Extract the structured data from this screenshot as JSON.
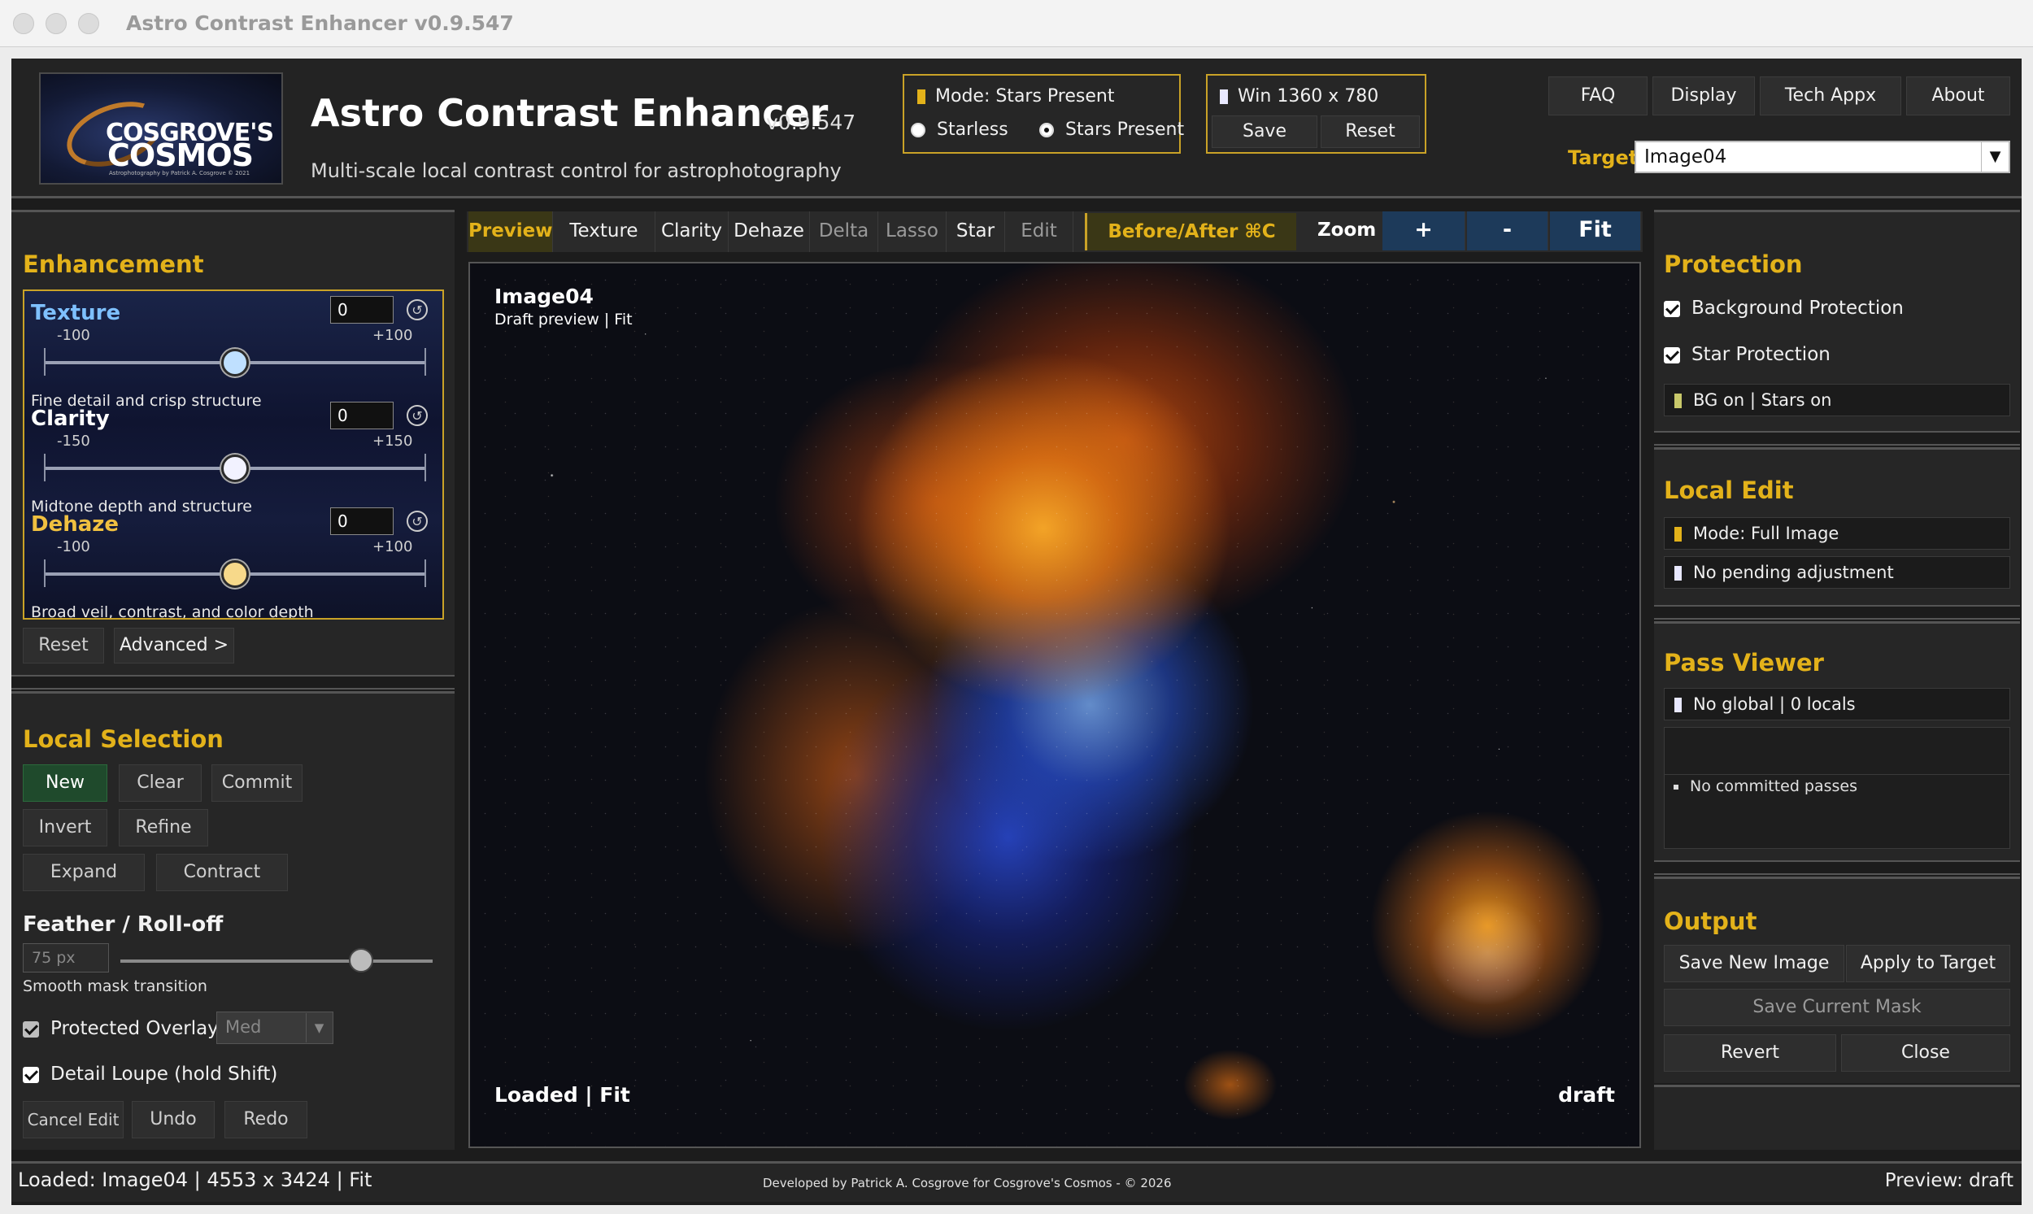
{
  "window": {
    "title": "Astro Contrast Enhancer v0.9.547"
  },
  "logo": {
    "line1": "COSGROVE'S",
    "line2": "COSMOS",
    "tagline": "Astrophotography by Patrick A. Cosgrove © 2021"
  },
  "header": {
    "title": "Astro Contrast Enhancer",
    "version": "v0.9.547",
    "subtitle": "Multi-scale local contrast control for astrophotography",
    "mode": {
      "label": "Mode: Stars Present",
      "options": [
        "Starless",
        "Stars Present"
      ],
      "selected": "Stars Present"
    },
    "window_size": {
      "label": "Win 1360 x 780",
      "save": "Save",
      "reset": "Reset"
    },
    "nav": [
      "FAQ",
      "Display",
      "Tech Appx",
      "About"
    ],
    "target_label": "Target",
    "target_value": "Image04"
  },
  "enhancement": {
    "heading": "Enhancement",
    "sliders": [
      {
        "name": "Texture",
        "value": "0",
        "min": "-100",
        "max": "+100",
        "desc": "Fine detail and crisp structure",
        "color": "#7ec0ff",
        "knob": "#bfe0ff"
      },
      {
        "name": "Clarity",
        "value": "0",
        "min": "-150",
        "max": "+150",
        "desc": "Midtone depth and structure",
        "color": "#ffffff",
        "knob": "#f2f2ff"
      },
      {
        "name": "Dehaze",
        "value": "0",
        "min": "-100",
        "max": "+100",
        "desc": "Broad veil, contrast, and color depth",
        "color": "#f0c040",
        "knob": "#f7d98a"
      }
    ],
    "reset": "Reset",
    "advanced": "Advanced >"
  },
  "local_selection": {
    "heading": "Local Selection",
    "buttons": {
      "new": "New",
      "clear": "Clear",
      "commit": "Commit",
      "invert": "Invert",
      "refine": "Refine",
      "expand": "Expand",
      "contract": "Contract"
    },
    "feather_heading": "Feather / Roll-off",
    "feather_value": "75 px",
    "feather_level": 0.77,
    "feather_desc": "Smooth mask transition",
    "protected_overlay": "Protected Overlay",
    "overlay_level": "Med",
    "detail_loupe": "Detail Loupe (hold Shift)",
    "cancel_edit": "Cancel Edit",
    "undo": "Undo",
    "redo": "Redo"
  },
  "tabs": [
    "Preview",
    "Texture",
    "Clarity",
    "Dehaze",
    "Delta",
    "Lasso",
    "Star",
    "Edit"
  ],
  "active_tab": "Preview",
  "before_after": "Before/After ⌘C",
  "zoom": {
    "label": "Zoom",
    "plus": "+",
    "minus": "-",
    "fit": "Fit"
  },
  "preview": {
    "image_name": "Image04",
    "info": "Draft preview | Fit",
    "status_left": "Loaded | Fit",
    "status_right": "draft"
  },
  "protection": {
    "heading": "Protection",
    "background": "Background Protection",
    "star": "Star Protection",
    "status": "BG on | Stars on"
  },
  "local_edit": {
    "heading": "Local Edit",
    "mode": "Mode: Full Image",
    "pending": "No pending adjustment"
  },
  "pass_viewer": {
    "heading": "Pass Viewer",
    "summary": "No global | 0 locals",
    "list_item": "No committed passes"
  },
  "output": {
    "heading": "Output",
    "save_new": "Save New Image",
    "apply": "Apply to Target",
    "save_mask": "Save Current Mask",
    "revert": "Revert",
    "close": "Close"
  },
  "status_bar": {
    "left": "Loaded: Image04 | 4553 x 3424 | Fit",
    "center": "Developed by Patrick A. Cosgrove for Cosgrove's Cosmos - © 2026",
    "right": "Preview: draft"
  },
  "colors": {
    "accent": "#e3b21a",
    "green_button": "#1f4a2c",
    "zoom_button": "#1d3a5a"
  }
}
